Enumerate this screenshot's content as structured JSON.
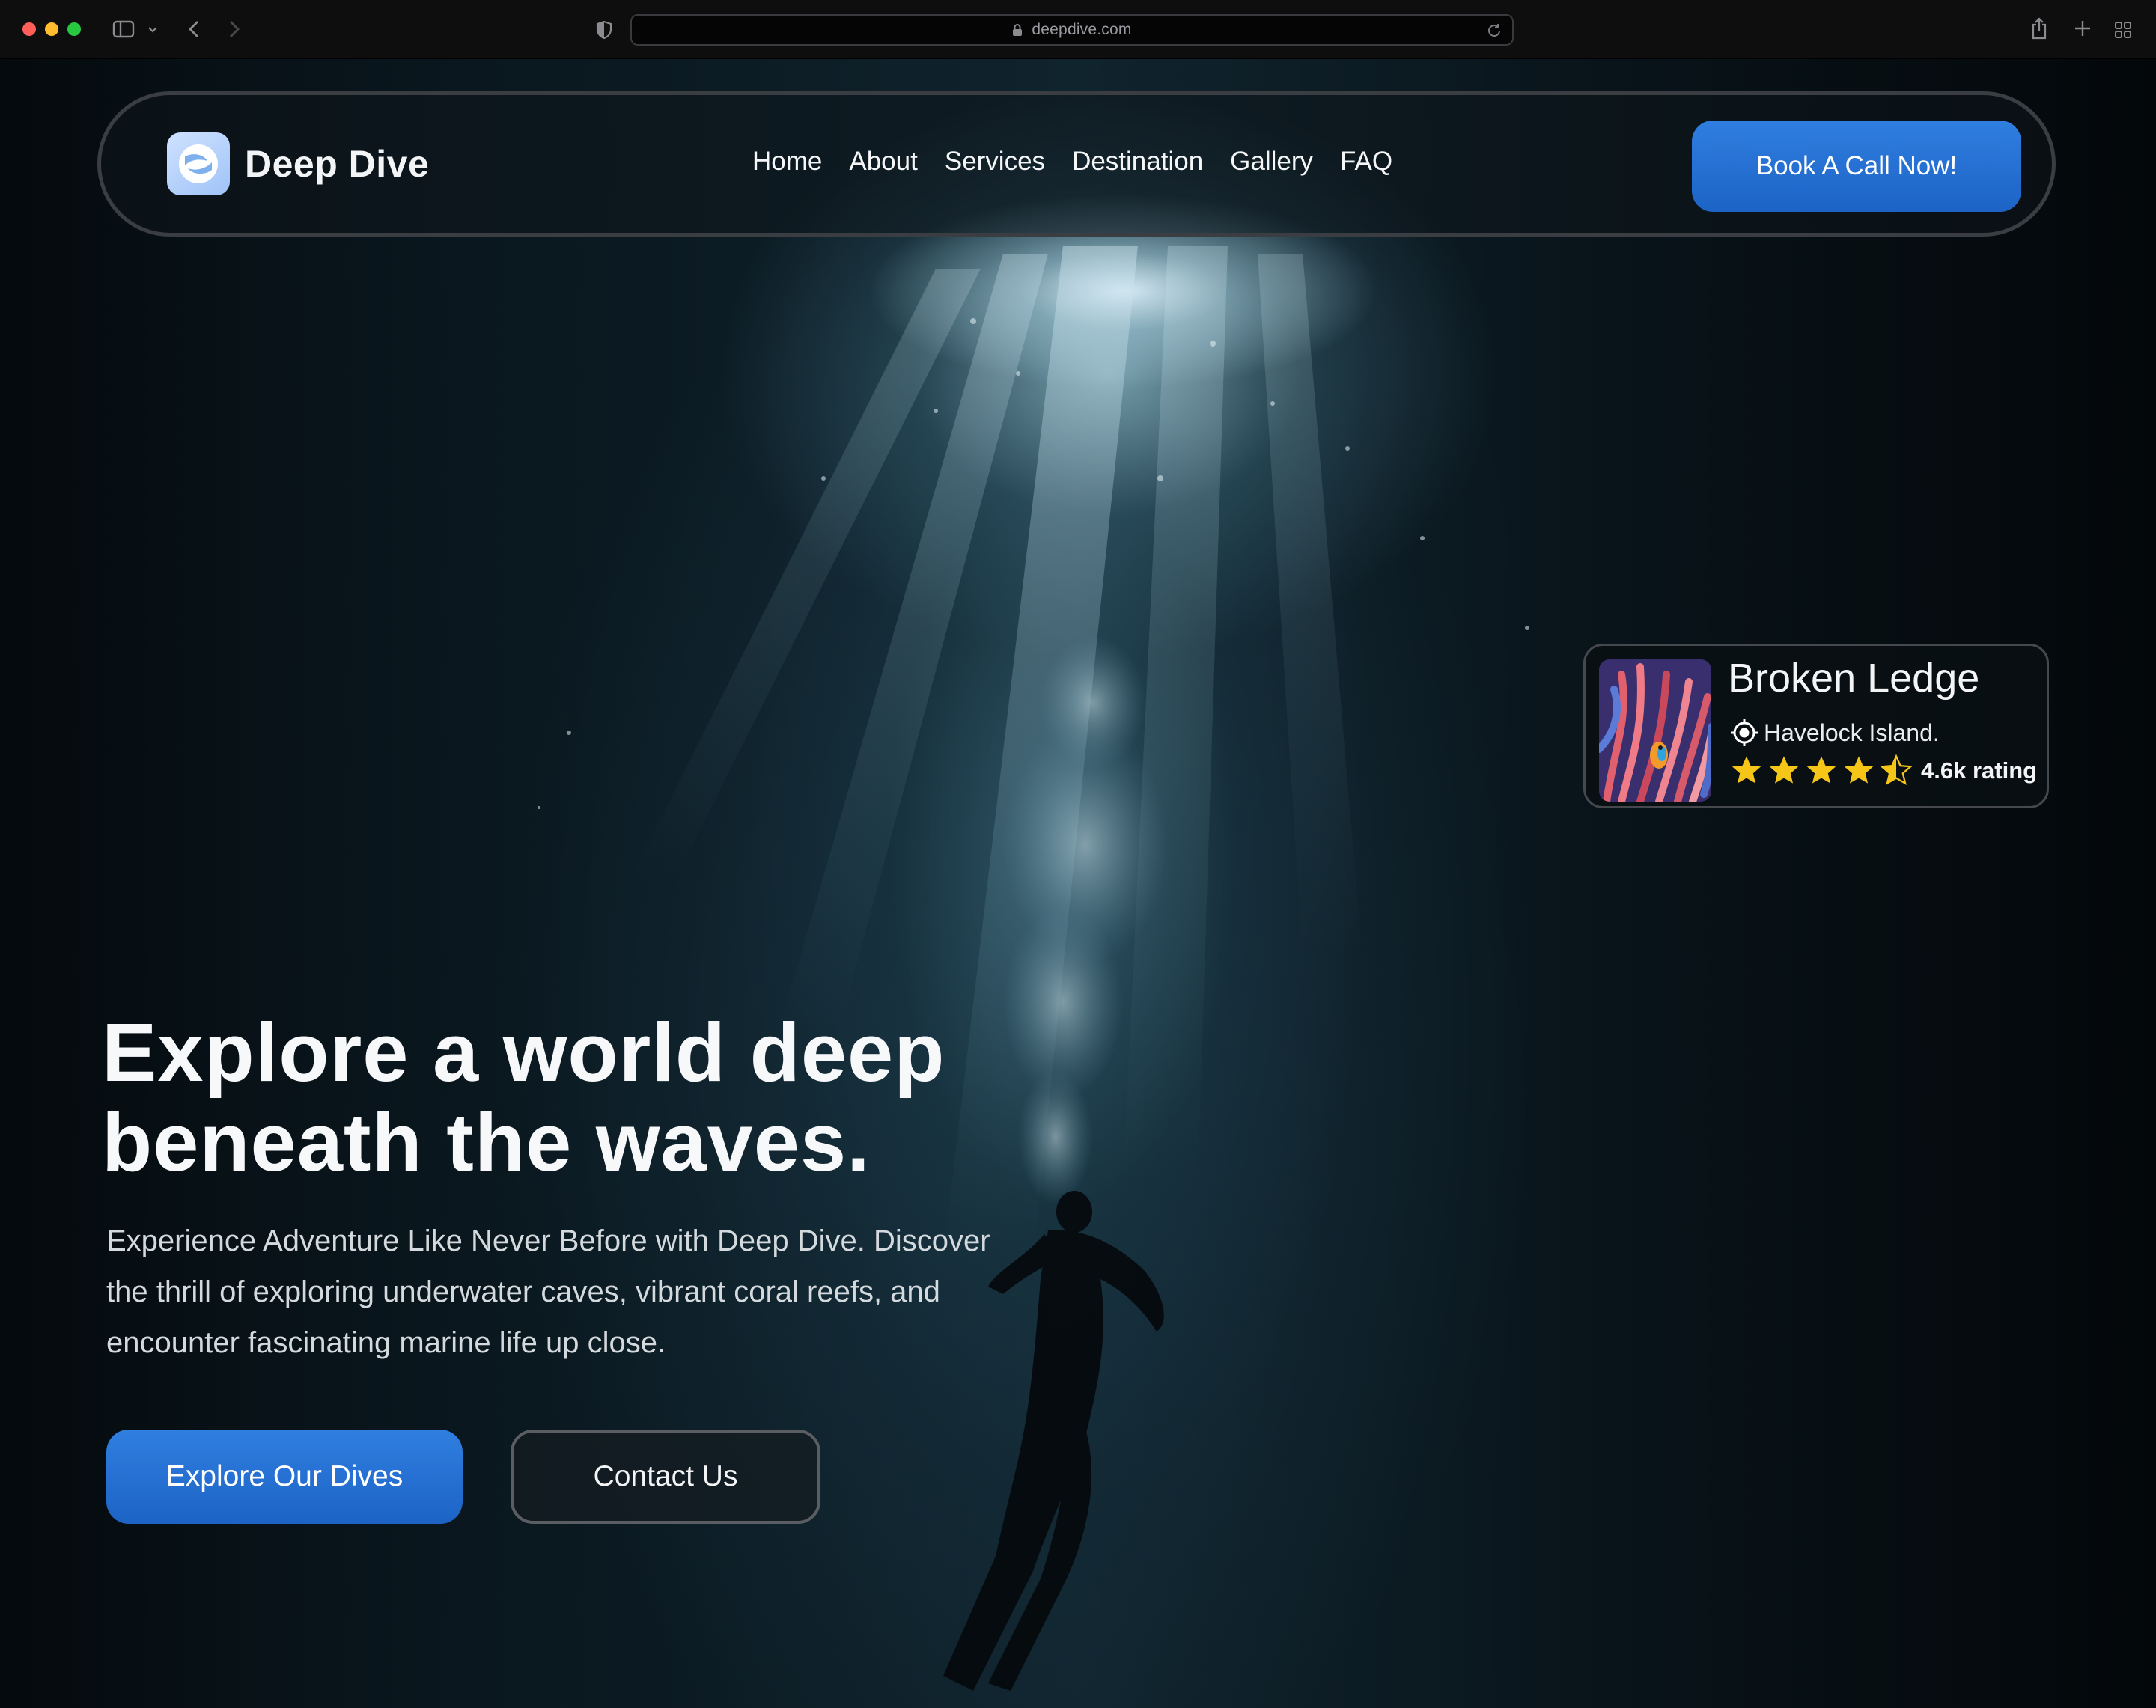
{
  "browser": {
    "url": "deepdive.com"
  },
  "nav": {
    "brand": "Deep Dive",
    "links": [
      "Home",
      "About",
      "Services",
      "Destination",
      "Gallery",
      "FAQ"
    ],
    "cta": "Book A Call Now!"
  },
  "destination_card": {
    "title": "Broken Ledge",
    "location": "Havelock Island.",
    "rating_stars": 4.5,
    "rating_text": "4.6k rating"
  },
  "hero": {
    "title_line1": "Explore a world deep",
    "title_line2": "beneath the waves.",
    "subtitle_line1": "Experience Adventure Like Never Before with Deep Dive. Discover",
    "subtitle_line2": "the thrill of exploring underwater caves, vibrant coral reefs, and",
    "subtitle_line3": "encounter fascinating marine life up close.",
    "primary_button": "Explore Our Dives",
    "secondary_button": "Contact Us"
  },
  "colors": {
    "accent": "#2f7fe0",
    "accent_dark": "#1d63c6",
    "star": "#f5c518",
    "text": "#f4f6f8"
  }
}
